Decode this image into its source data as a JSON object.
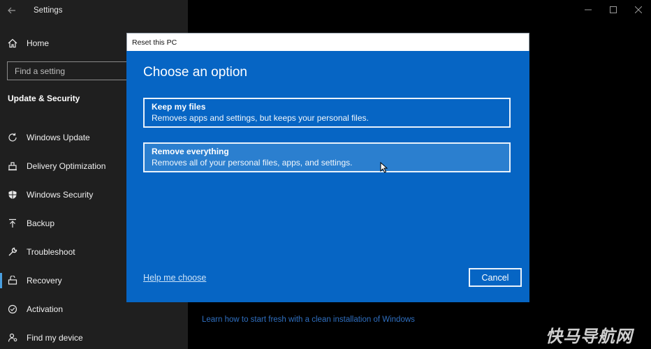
{
  "window": {
    "title": "Settings"
  },
  "sidebar": {
    "home_label": "Home",
    "search_placeholder": "Find a setting",
    "section_title": "Update & Security",
    "items": [
      {
        "label": "Windows Update",
        "icon": "refresh-icon"
      },
      {
        "label": "Delivery Optimization",
        "icon": "delivery-icon"
      },
      {
        "label": "Windows Security",
        "icon": "shield-icon"
      },
      {
        "label": "Backup",
        "icon": "upload-icon"
      },
      {
        "label": "Troubleshoot",
        "icon": "wrench-icon"
      },
      {
        "label": "Recovery",
        "icon": "recovery-icon"
      },
      {
        "label": "Activation",
        "icon": "check-circle-icon"
      },
      {
        "label": "Find my device",
        "icon": "person-location-icon"
      }
    ],
    "active_item": "Recovery"
  },
  "main": {
    "learn_link": "Learn how to start fresh with a clean installation of Windows"
  },
  "dialog": {
    "title": "Reset this PC",
    "heading": "Choose an option",
    "options": [
      {
        "title": "Keep my files",
        "description": "Removes apps and settings, but keeps your personal files."
      },
      {
        "title": "Remove everything",
        "description": "Removes all of your personal files, apps, and settings."
      }
    ],
    "help_link": "Help me choose",
    "cancel_label": "Cancel",
    "colors": {
      "background": "#0665c4",
      "hover": "#2b7fcf"
    }
  },
  "watermark": "快马导航网"
}
